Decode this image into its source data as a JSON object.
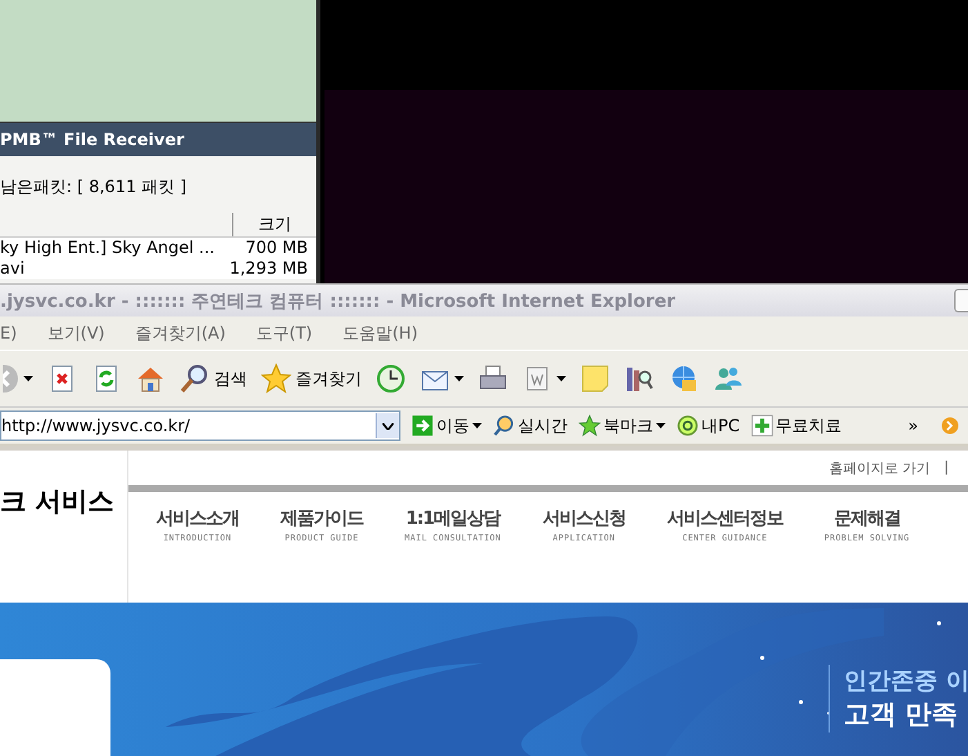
{
  "file_receiver": {
    "title": "PMB™ File Receiver",
    "packets": "남은패킷: [ 8,611 패킷 ]",
    "columns": [
      "크기"
    ],
    "rows": [
      {
        "name": "ky High Ent.] Sky Angel ...",
        "size": "700 MB"
      },
      {
        "name": "avi",
        "size": "1,293 MB"
      }
    ]
  },
  "browser": {
    "title": ".jysvc.co.kr - ::::::: 주연테크 컴퓨터 ::::::: - Microsoft Internet Explorer",
    "menu": [
      "E)",
      "보기(V)",
      "즐겨찾기(A)",
      "도구(T)",
      "도움말(H)"
    ],
    "toolbar": [
      {
        "kind": "back",
        "caret": true
      },
      {
        "kind": "stop"
      },
      {
        "kind": "refresh"
      },
      {
        "kind": "home"
      },
      {
        "kind": "search",
        "label": "검색"
      },
      {
        "kind": "favorites",
        "label": "즐겨찾기"
      },
      {
        "kind": "history"
      },
      {
        "kind": "mail",
        "caret": true
      },
      {
        "kind": "print"
      },
      {
        "kind": "word",
        "caret": true
      },
      {
        "kind": "note"
      },
      {
        "kind": "research"
      },
      {
        "kind": "globe"
      },
      {
        "kind": "messenger"
      }
    ],
    "address": "http://www.jysvc.co.kr/",
    "links": [
      {
        "kind": "go",
        "label": "이동",
        "caret": true
      },
      {
        "kind": "live",
        "label": "실시간",
        "caret": false
      },
      {
        "kind": "star",
        "label": "북마크",
        "caret": true
      },
      {
        "kind": "pc",
        "label": "내PC",
        "caret": false
      },
      {
        "kind": "plus",
        "label": "무료치료",
        "caret": false
      }
    ],
    "more": "»"
  },
  "page": {
    "logo": "크 서비스",
    "top_links": [
      "홈페이지로 가기",
      "|"
    ],
    "nav": [
      {
        "label": "서비스소개",
        "sub": "INTRODUCTION"
      },
      {
        "label": "제품가이드",
        "sub": "PRODUCT GUIDE"
      },
      {
        "label": "1:1메일상담",
        "sub": "MAIL CONSULTATION"
      },
      {
        "label": "서비스신청",
        "sub": "APPLICATION"
      },
      {
        "label": "서비스센터정보",
        "sub": "CENTER GUIDANCE"
      },
      {
        "label": "문제해결",
        "sub": "PROBLEM SOLVING"
      }
    ],
    "banner": [
      "인간존중 이",
      "고객 만족"
    ]
  }
}
